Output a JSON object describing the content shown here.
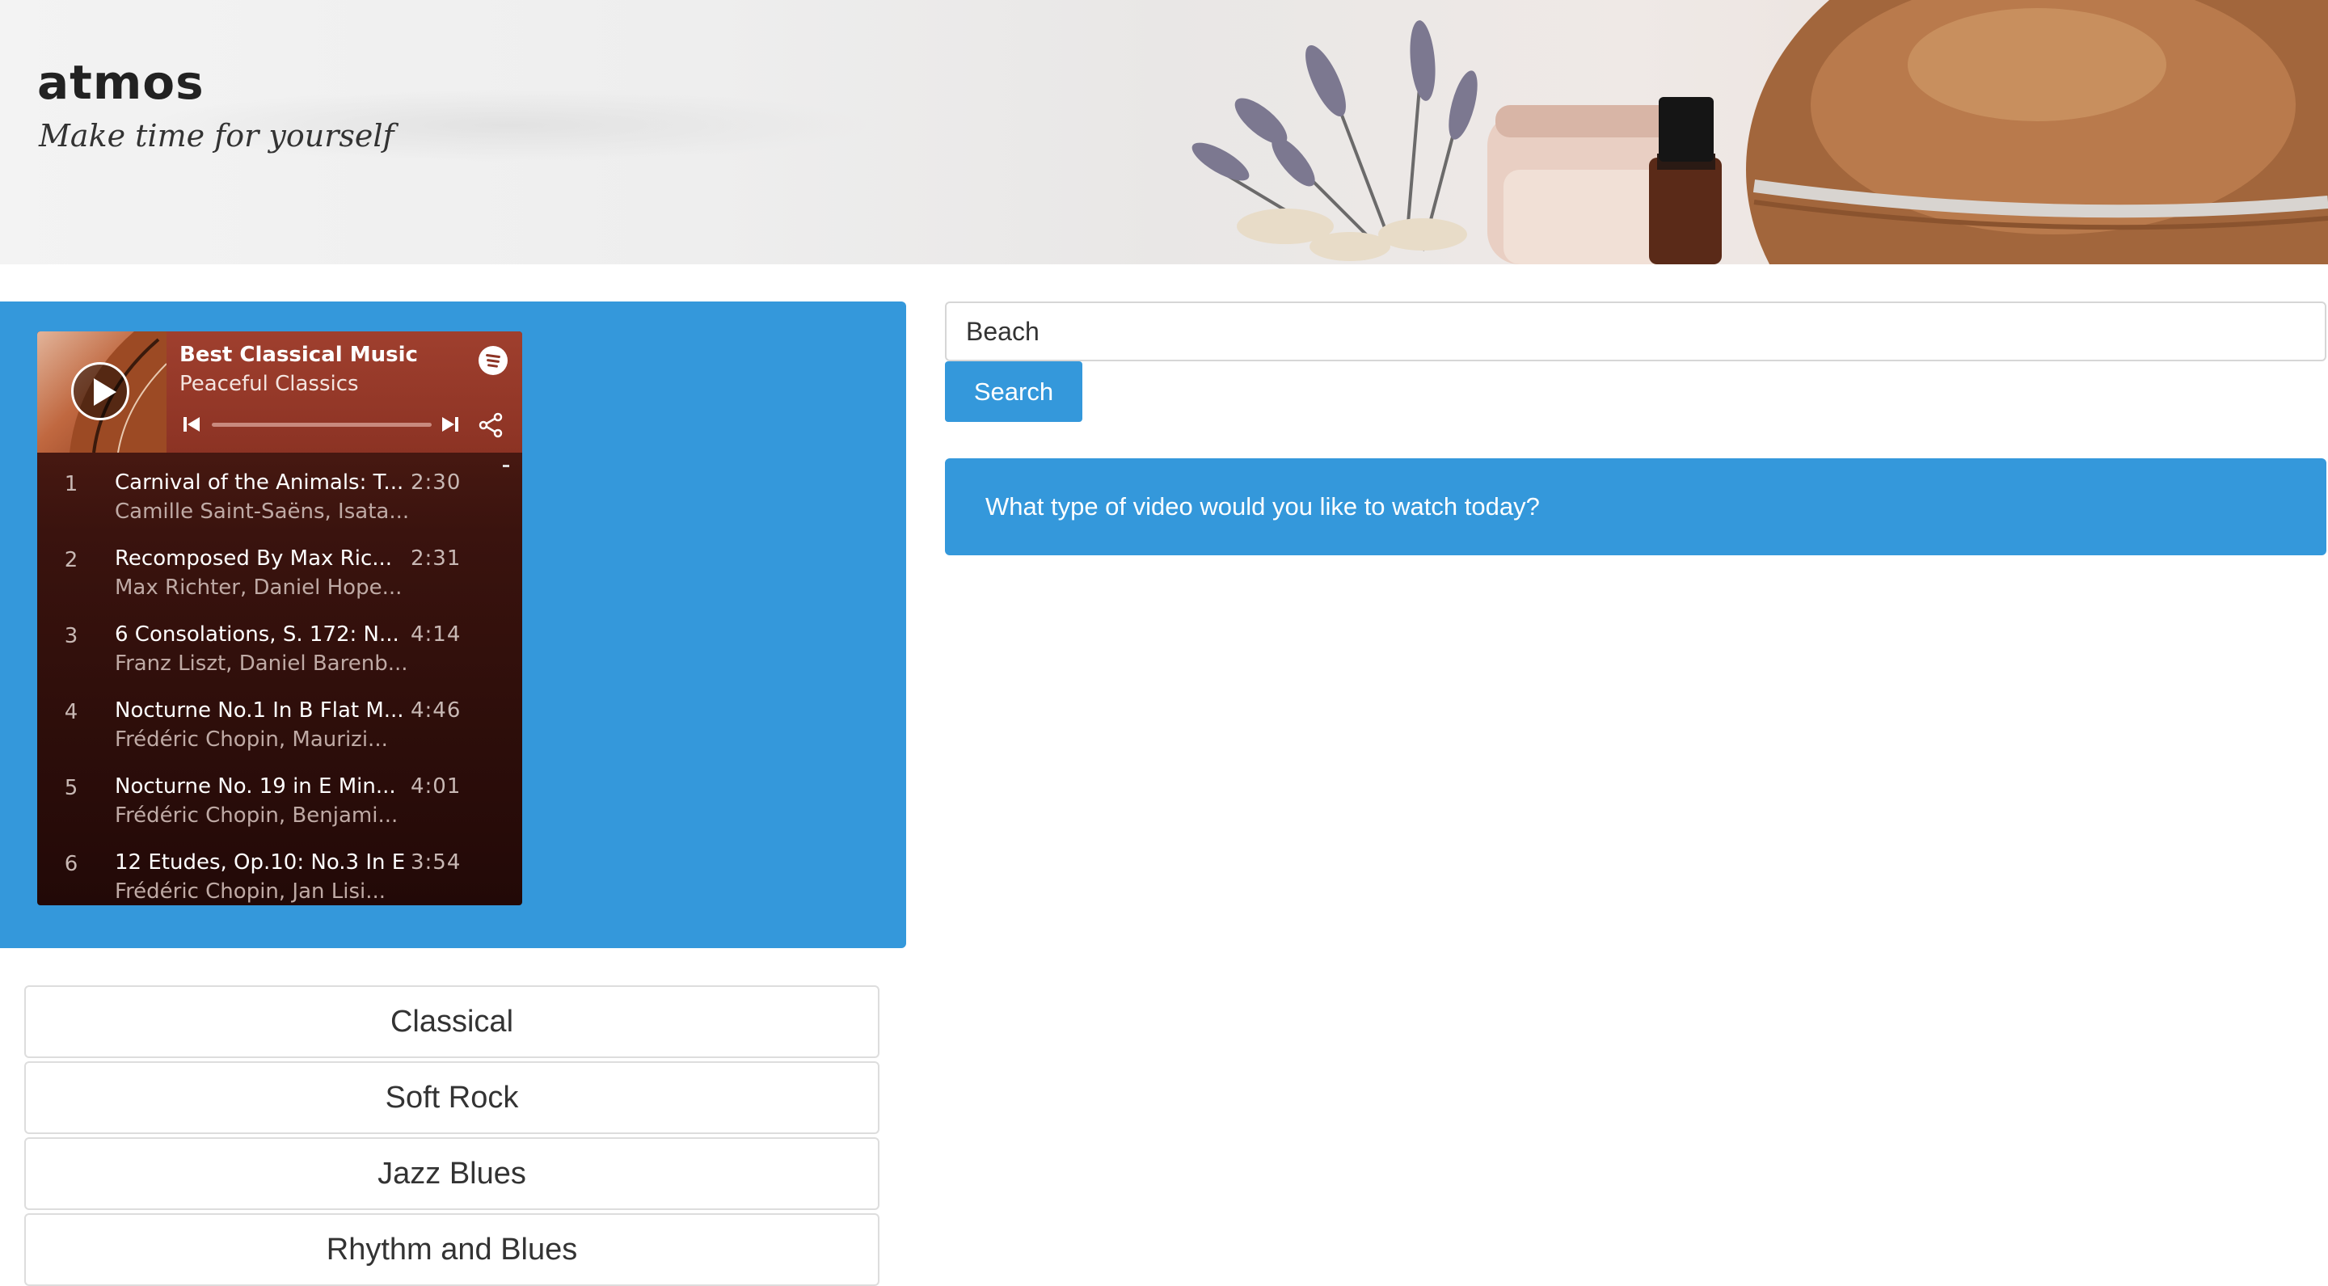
{
  "brand": {
    "title": "atmos",
    "tagline": "Make time for yourself"
  },
  "player": {
    "playlist_title": "Best Classical Music",
    "playlist_subtitle": "Peaceful Classics",
    "icons": [
      "play-icon",
      "spotify-logo",
      "previous-icon",
      "next-icon",
      "share-icon"
    ],
    "tracks": [
      {
        "num": "1",
        "title": "Carnival of the Animals: T...",
        "artist": "Camille Saint-Saëns, Isata...",
        "duration": "2:30"
      },
      {
        "num": "2",
        "title": "Recomposed By Max Ric...",
        "artist": "Max Richter, Daniel Hope...",
        "duration": "2:31"
      },
      {
        "num": "3",
        "title": "6 Consolations, S. 172: N...",
        "artist": "Franz Liszt, Daniel Barenb...",
        "duration": "4:14"
      },
      {
        "num": "4",
        "title": "Nocturne No.1 In B Flat M...",
        "artist": "Frédéric Chopin, Maurizi...",
        "duration": "4:46"
      },
      {
        "num": "5",
        "title": "Nocturne No. 19 in E Min...",
        "artist": "Frédéric Chopin, Benjami...",
        "duration": "4:01"
      },
      {
        "num": "6",
        "title": "12 Etudes, Op.10: No.3 In E",
        "artist": "Frédéric Chopin, Jan Lisi...",
        "duration": "3:54"
      }
    ]
  },
  "genres": [
    "Classical",
    "Soft Rock",
    "Jazz Blues",
    "Rhythm and Blues"
  ],
  "search": {
    "value": "Beach",
    "button_label": "Search"
  },
  "prompt": "What type of video would you like to watch today?",
  "colors": {
    "accent": "#3498db",
    "player_header": "#8c3324",
    "player_body": "#2a0c08"
  }
}
